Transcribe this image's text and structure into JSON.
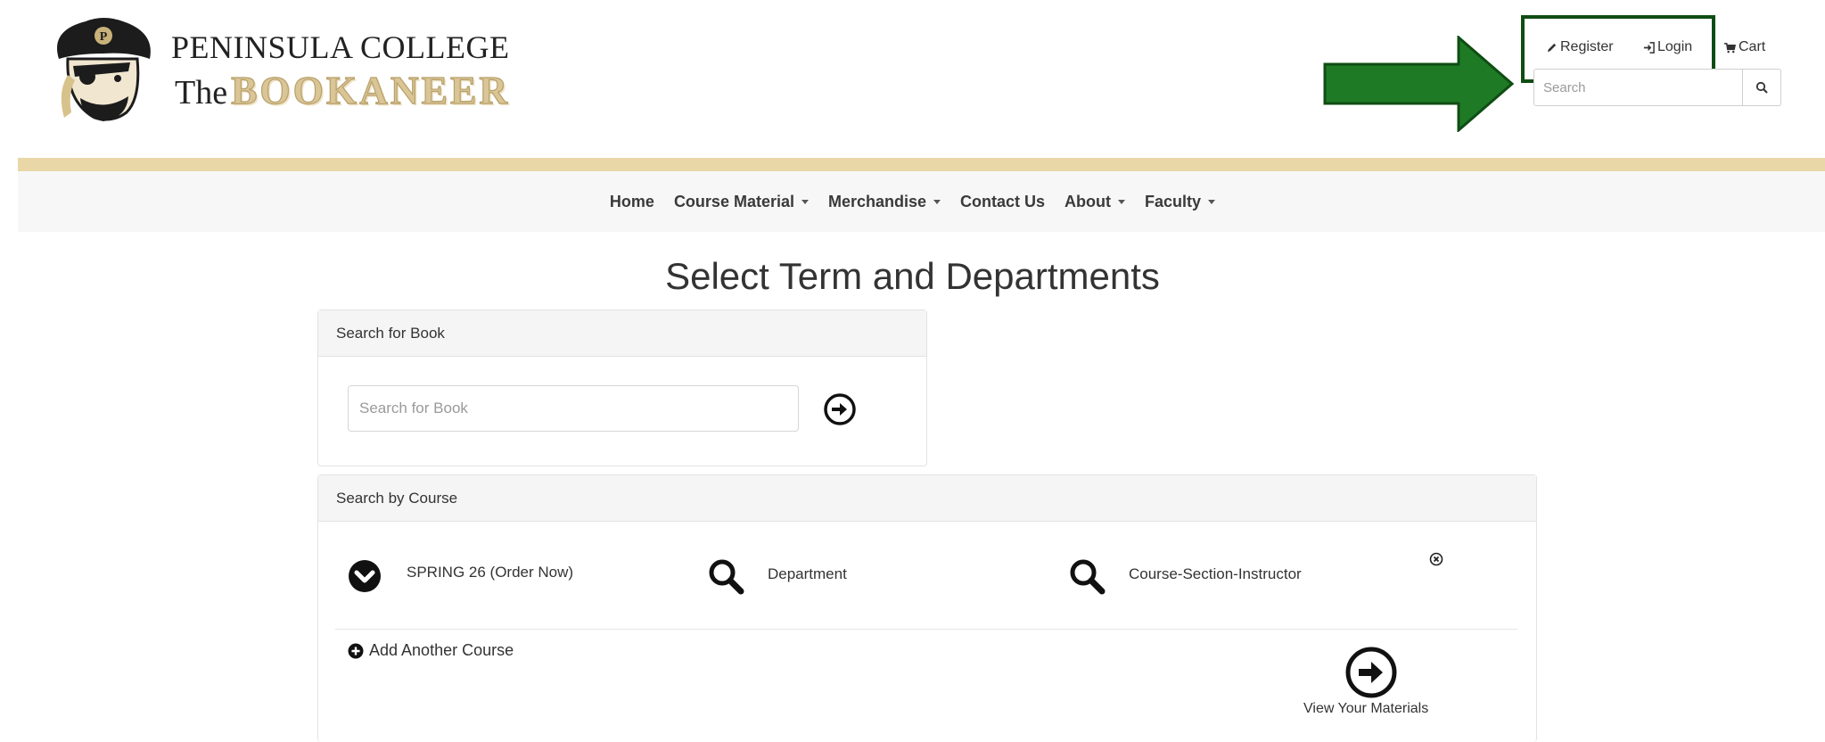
{
  "header": {
    "brand_college": "PENINSULA COLLEGE",
    "brand_the": "The",
    "brand_bookaneer": "BOOKANEER",
    "logo_icon": "pirate-mascot-icon"
  },
  "top_links": {
    "register": "Register",
    "login": "Login",
    "cart": "Cart"
  },
  "search": {
    "placeholder": "Search"
  },
  "nav": {
    "home": "Home",
    "course_material": "Course Material",
    "merchandise": "Merchandise",
    "contact_us": "Contact Us",
    "about": "About",
    "faculty": "Faculty"
  },
  "page": {
    "title": "Select Term and Departments"
  },
  "book_panel": {
    "heading": "Search for Book",
    "placeholder": "Search for Book"
  },
  "course_panel": {
    "heading": "Search by Course",
    "term": "SPRING 26 (Order Now)",
    "department": "Department",
    "course_section_instructor": "Course-Section-Instructor",
    "add_another": "Add Another Course",
    "view_materials": "View Your Materials"
  },
  "colors": {
    "gold": "#e9d7a8",
    "highlight_green": "#0f4d14",
    "arrow_green": "#1f7a25"
  }
}
